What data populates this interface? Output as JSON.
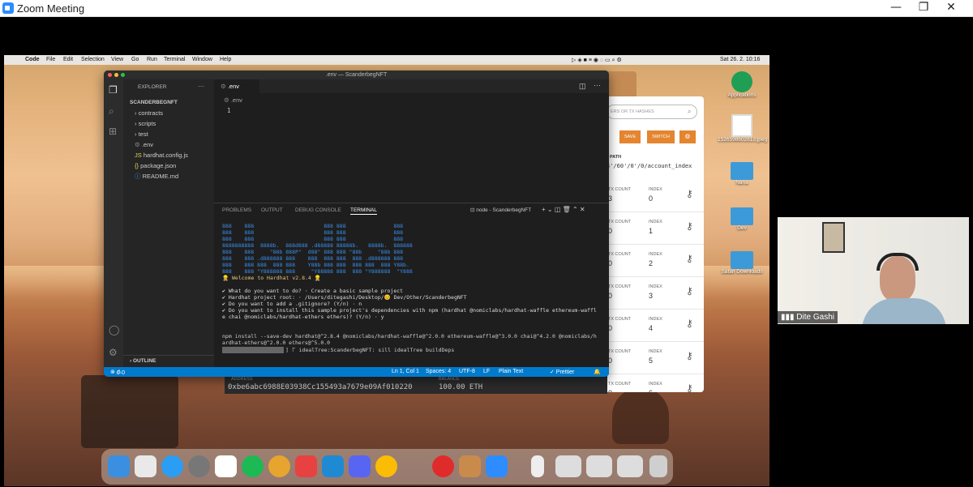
{
  "zoom": {
    "title": "Zoom Meeting"
  },
  "mac_menubar": {
    "app": "Code",
    "items": [
      "File",
      "Edit",
      "Selection",
      "View",
      "Go",
      "Run",
      "Terminal",
      "Window",
      "Help"
    ],
    "clock": "Sat 26. 2.  10:16"
  },
  "vscode": {
    "window_title": ".env — ScanderbegNFT",
    "explorer_title": "EXPLORER",
    "project": "SCANDERBEGNFT",
    "tree": [
      "contracts",
      "scripts",
      "test",
      ".env",
      "hardhat.config.js",
      "package.json",
      "README.md"
    ],
    "outline": "OUTLINE",
    "tab": ".env",
    "breadcrumb": ".env",
    "line_number": "1",
    "panel_tabs": [
      "PROBLEMS",
      "OUTPUT",
      "DEBUG CONSOLE",
      "TERMINAL"
    ],
    "terminal_selector": "node - ScanderbegNFT",
    "terminal": {
      "welcome": "👷 Welcome to Hardhat v2.8.4 👷",
      "q1": "✔ What do you want to do? · Create a basic sample project",
      "q2": "✔ Hardhat project root: · /Users/ditegashi/Desktop/😊 Dev/Other/ScanderbegNFT",
      "q3": "✔ Do you want to add a .gitignore? (Y/n) · n",
      "q4a": "✔ Do you want to install this sample project's dependencies with npm (hardhat @nomiclabs/hardhat-waffle ethereum-waffl",
      "q4b": "e chai @nomiclabs/hardhat-ethers ethers)? (Y/n) · y",
      "cmd1": "npm install --save-dev hardhat@^2.8.4 @nomiclabs/hardhat-waffle@^2.0.0 ethereum-waffle@^3.0.0 chai@^4.2.0 @nomiclabs/h",
      "cmd2": "ardhat-ethers@^2.0.0 ethers@^5.0.0",
      "progress": "] ⠏ idealTree:ScanderbegNFT: sill idealTree buildDeps"
    },
    "status": {
      "errors": "0",
      "warnings": "0",
      "position": "Ln 1, Col 1",
      "spaces": "Spaces: 4",
      "encoding": "UTF-8",
      "eol": "LF",
      "language": "Plain Text",
      "formatter": "✓ Prettier"
    }
  },
  "wallet": {
    "search_placeholder": "ERS OR TX HASHES",
    "save": "SAVE",
    "switch": "SWITCH",
    "path_label": "PATH",
    "path_value": "4'/60'/0'/0/account_index",
    "rows": [
      {
        "tx": "TX COUNT",
        "txv": "3",
        "idx": "INDEX",
        "idxv": "0"
      },
      {
        "tx": "TX COUNT",
        "txv": "0",
        "idx": "INDEX",
        "idxv": "1"
      },
      {
        "tx": "TX COUNT",
        "txv": "0",
        "idx": "INDEX",
        "idxv": "2"
      },
      {
        "tx": "TX COUNT",
        "txv": "0",
        "idx": "INDEX",
        "idxv": "3"
      },
      {
        "tx": "TX COUNT",
        "txv": "0",
        "idx": "INDEX",
        "idxv": "4"
      },
      {
        "tx": "TX COUNT",
        "txv": "0",
        "idx": "INDEX",
        "idxv": "5"
      },
      {
        "tx": "TX COUNT",
        "txv": "0",
        "idx": "INDEX",
        "idxv": "6"
      }
    ]
  },
  "bottom": {
    "address_label": "ADDRESS",
    "address": "0xbe6abc6988E03938Cc155493a7679e09Af010220",
    "balance_label": "BALANCE",
    "balance": "100.00 ETH"
  },
  "desktop": {
    "applications": "Applications",
    "file": "1526598602813.jpeg",
    "nana": "Nana",
    "dev": "Dev",
    "safari": "Safari Downloads"
  },
  "participant": {
    "name": "Dite Gashi"
  }
}
